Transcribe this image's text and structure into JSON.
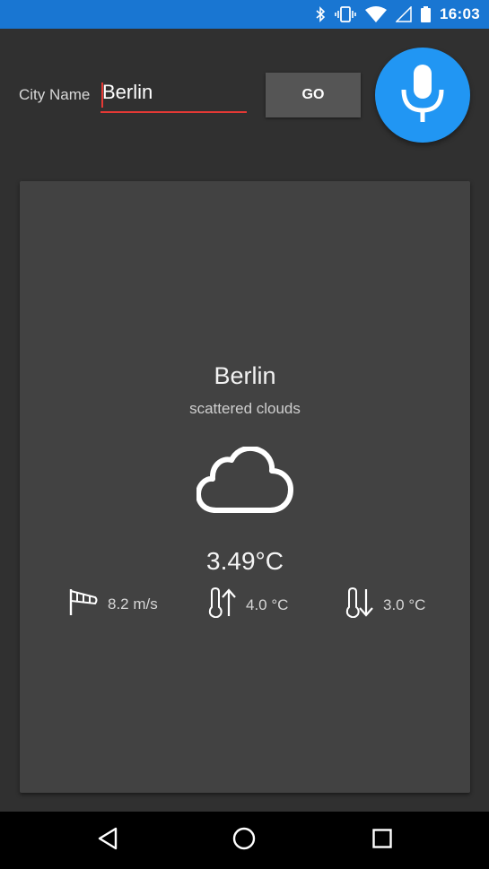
{
  "status_bar": {
    "time": "16:03",
    "icons": [
      "bluetooth-icon",
      "vibrate-icon",
      "wifi-icon",
      "signal-icon",
      "battery-icon"
    ]
  },
  "search": {
    "label": "City Name",
    "value": "Berlin",
    "go_label": "GO",
    "mic_icon": "microphone-icon"
  },
  "weather": {
    "city": "Berlin",
    "description": "scattered clouds",
    "icon": "cloud-icon",
    "temperature": "3.49°C",
    "wind": "8.2 m/s",
    "temp_max": "4.0 °C",
    "temp_min": "3.0 °C"
  },
  "nav": {
    "icons": [
      "back-icon",
      "home-icon",
      "recents-icon"
    ]
  },
  "colors": {
    "accent": "#2196f3",
    "status_bar": "#1976d2",
    "input_underline": "#e53935",
    "card": "#424242",
    "background": "#303030"
  }
}
